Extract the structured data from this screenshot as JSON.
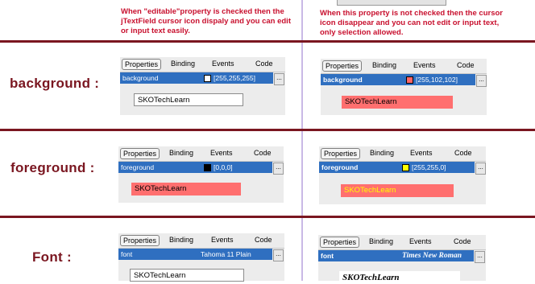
{
  "notes": {
    "left": "When \"editable\"property is checked then the jTextField cursor icon dispaly and you can edit or input text easily.",
    "right": "When this property is not checked then the cursor icon disappear and you can not edit or input text, only selection allowed."
  },
  "tabs": [
    "Properties",
    "Binding",
    "Events",
    "Code"
  ],
  "ellipsis": "...",
  "colors": {
    "divider": "#7a1620",
    "label": "#7a1620",
    "note": "#c8102e",
    "selected_row": "#2f6fc0",
    "field_red": "#ff6f6f"
  },
  "rows": [
    {
      "label": "background :",
      "left": {
        "property": "background",
        "value": "[255,255,255]",
        "swatch": "#ffffff",
        "field_text": "SKOTechLearn"
      },
      "right": {
        "property": "background",
        "value": "[255,102,102]",
        "swatch": "#ff6666",
        "field_text": "SKOTechLearn"
      }
    },
    {
      "label": "foreground :",
      "left": {
        "property": "foreground",
        "value": "[0,0,0]",
        "swatch": "#000000",
        "field_text": "SKOTechLearn"
      },
      "right": {
        "property": "foreground",
        "value": "[255,255,0]",
        "swatch": "#ffff00",
        "field_text": "SKOTechLearn"
      }
    },
    {
      "label": "Font :",
      "left": {
        "property": "font",
        "value": "Tahoma 11 Plain",
        "field_text": "SKOTechLearn"
      },
      "right": {
        "property": "font",
        "value": "Times New Roman",
        "field_text": "SKOTechLearn"
      }
    }
  ]
}
